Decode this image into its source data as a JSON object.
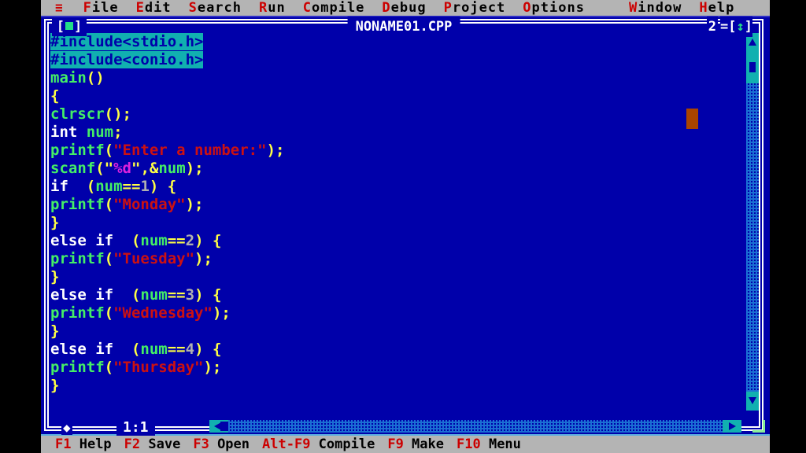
{
  "menubar": {
    "hamburger_icon": "≡",
    "items": [
      {
        "label": "File",
        "hotkey": "F"
      },
      {
        "label": "Edit",
        "hotkey": "E"
      },
      {
        "label": "Search",
        "hotkey": "S"
      },
      {
        "label": "Run",
        "hotkey": "R"
      },
      {
        "label": "Compile",
        "hotkey": "C"
      },
      {
        "label": "Debug",
        "hotkey": "D"
      },
      {
        "label": "Project",
        "hotkey": "P"
      },
      {
        "label": "Options",
        "hotkey": "O"
      },
      {
        "label": "Window",
        "hotkey": "W"
      },
      {
        "label": "Help",
        "hotkey": "H"
      }
    ]
  },
  "window": {
    "title": "NONAME01.CPP",
    "number": "2",
    "close_box_left": "[",
    "close_box_right": "]",
    "zoom_box": "[↕]",
    "cursor_position": "1:1",
    "drag_marker": "◆"
  },
  "editor": {
    "lines": [
      {
        "n": 1,
        "tokens": [
          {
            "t": "#include<stdio.h>",
            "c": "pp"
          }
        ]
      },
      {
        "n": 2,
        "tokens": [
          {
            "t": "#include<conio.h>",
            "c": "pp"
          }
        ]
      },
      {
        "n": 3,
        "tokens": [
          {
            "t": "main",
            "c": "id"
          },
          {
            "t": "()",
            "c": "pun"
          }
        ]
      },
      {
        "n": 4,
        "tokens": [
          {
            "t": "{",
            "c": "pun"
          }
        ]
      },
      {
        "n": 5,
        "tokens": [
          {
            "t": "clrscr",
            "c": "id"
          },
          {
            "t": "();",
            "c": "pun"
          }
        ]
      },
      {
        "n": 6,
        "tokens": [
          {
            "t": "int ",
            "c": "kw"
          },
          {
            "t": "num",
            "c": "id"
          },
          {
            "t": ";",
            "c": "pun"
          }
        ]
      },
      {
        "n": 7,
        "tokens": [
          {
            "t": "printf",
            "c": "id"
          },
          {
            "t": "(",
            "c": "pun"
          },
          {
            "t": "\"Enter a number:\"",
            "c": "str"
          },
          {
            "t": ");",
            "c": "pun"
          }
        ]
      },
      {
        "n": 8,
        "tokens": [
          {
            "t": "scanf",
            "c": "id"
          },
          {
            "t": "(",
            "c": "pun"
          },
          {
            "t": "\"",
            "c": "quo"
          },
          {
            "t": "%d",
            "c": "fmt"
          },
          {
            "t": "\"",
            "c": "quo"
          },
          {
            "t": ",",
            "c": "pun"
          },
          {
            "t": "&",
            "c": "pun"
          },
          {
            "t": "num",
            "c": "id"
          },
          {
            "t": ");",
            "c": "pun"
          }
        ]
      },
      {
        "n": 9,
        "tokens": [
          {
            "t": "if ",
            "c": "kw"
          },
          {
            "t": " (",
            "c": "pun"
          },
          {
            "t": "num",
            "c": "id"
          },
          {
            "t": "==",
            "c": "pun"
          },
          {
            "t": "1",
            "c": "num"
          },
          {
            "t": ") {",
            "c": "pun"
          }
        ]
      },
      {
        "n": 10,
        "tokens": [
          {
            "t": "printf",
            "c": "id"
          },
          {
            "t": "(",
            "c": "pun"
          },
          {
            "t": "\"Monday\"",
            "c": "str"
          },
          {
            "t": ");",
            "c": "pun"
          }
        ]
      },
      {
        "n": 11,
        "tokens": [
          {
            "t": "}",
            "c": "pun"
          }
        ]
      },
      {
        "n": 12,
        "tokens": [
          {
            "t": "else if ",
            "c": "kw"
          },
          {
            "t": " (",
            "c": "pun"
          },
          {
            "t": "num",
            "c": "id"
          },
          {
            "t": "==",
            "c": "pun"
          },
          {
            "t": "2",
            "c": "num"
          },
          {
            "t": ") {",
            "c": "pun"
          }
        ]
      },
      {
        "n": 13,
        "tokens": [
          {
            "t": "printf",
            "c": "id"
          },
          {
            "t": "(",
            "c": "pun"
          },
          {
            "t": "\"Tuesday\"",
            "c": "str"
          },
          {
            "t": ");",
            "c": "pun"
          }
        ]
      },
      {
        "n": 14,
        "tokens": [
          {
            "t": "}",
            "c": "pun"
          }
        ]
      },
      {
        "n": 15,
        "tokens": [
          {
            "t": "else if ",
            "c": "kw"
          },
          {
            "t": " (",
            "c": "pun"
          },
          {
            "t": "num",
            "c": "id"
          },
          {
            "t": "==",
            "c": "pun"
          },
          {
            "t": "3",
            "c": "num"
          },
          {
            "t": ") {",
            "c": "pun"
          }
        ]
      },
      {
        "n": 16,
        "tokens": [
          {
            "t": "printf",
            "c": "id"
          },
          {
            "t": "(",
            "c": "pun"
          },
          {
            "t": "\"Wednesday\"",
            "c": "str"
          },
          {
            "t": ");",
            "c": "pun"
          }
        ]
      },
      {
        "n": 17,
        "tokens": [
          {
            "t": "}",
            "c": "pun"
          }
        ]
      },
      {
        "n": 18,
        "tokens": [
          {
            "t": "else if ",
            "c": "kw"
          },
          {
            "t": " (",
            "c": "pun"
          },
          {
            "t": "num",
            "c": "id"
          },
          {
            "t": "==",
            "c": "pun"
          },
          {
            "t": "4",
            "c": "num"
          },
          {
            "t": ") {",
            "c": "pun"
          }
        ]
      },
      {
        "n": 19,
        "tokens": [
          {
            "t": "printf",
            "c": "id"
          },
          {
            "t": "(",
            "c": "pun"
          },
          {
            "t": "\"Thursday\"",
            "c": "str"
          },
          {
            "t": ");",
            "c": "pun"
          }
        ]
      },
      {
        "n": 20,
        "tokens": [
          {
            "t": "}",
            "c": "pun"
          }
        ]
      }
    ]
  },
  "statusbar": {
    "items": [
      {
        "key": "F1",
        "label": "Help"
      },
      {
        "key": "F2",
        "label": "Save"
      },
      {
        "key": "F3",
        "label": "Open"
      },
      {
        "key": "Alt-F9",
        "label": "Compile"
      },
      {
        "key": "F9",
        "label": "Make"
      },
      {
        "key": "F10",
        "label": "Menu"
      }
    ]
  },
  "colors": {
    "desktop_blue": "#0000aa",
    "menu_gray": "#b4b4b4",
    "hotkey_red": "#cc0000",
    "selection_teal": "#11b0b0",
    "identifier_green": "#44ee66",
    "punctuation_yellow": "#ffff44",
    "string_red": "#cc1111",
    "format_magenta": "#dd22dd",
    "mouse_cursor_orange": "#aa4400"
  }
}
